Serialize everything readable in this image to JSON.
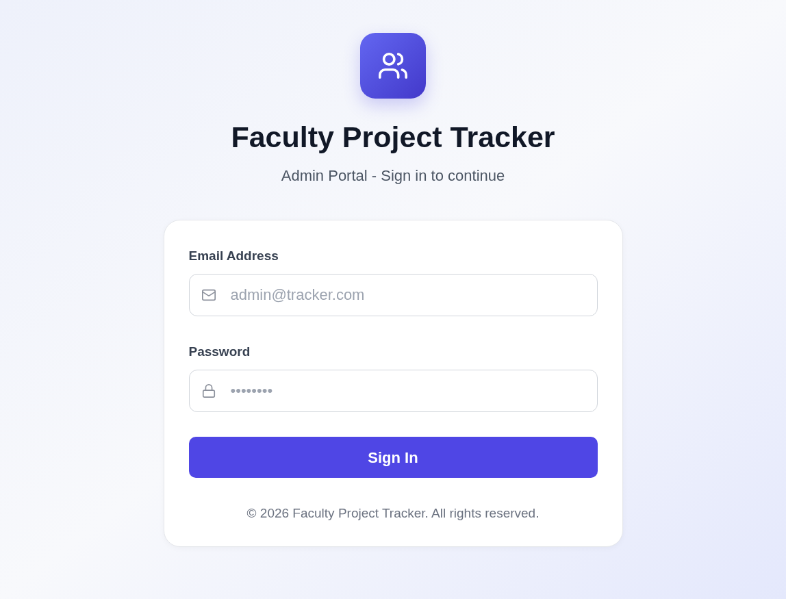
{
  "title": "Faculty Project Tracker",
  "subtitle": "Admin Portal - Sign in to continue",
  "form": {
    "fields": [
      {
        "kind": "email",
        "label": "Email Address",
        "placeholder": "admin@tracker.com"
      },
      {
        "kind": "password",
        "label": "Password",
        "placeholder": "••••••••"
      }
    ],
    "submit": "Sign In",
    "footer": "© 2026 Faculty Project Tracker. All rights reserved."
  }
}
